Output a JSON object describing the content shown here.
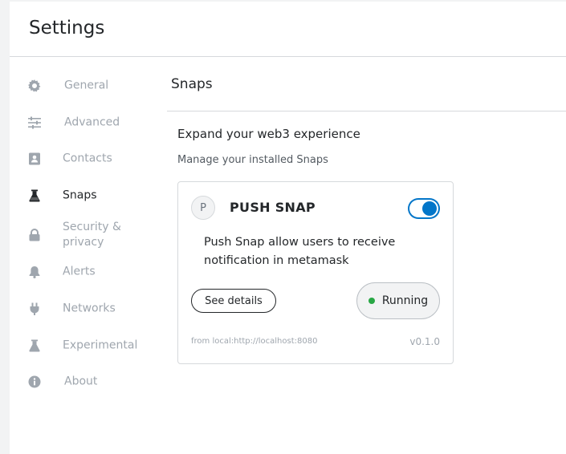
{
  "header": {
    "title": "Settings"
  },
  "sidebar": {
    "items": [
      {
        "label": "General",
        "icon": "gear-icon",
        "active": false
      },
      {
        "label": "Advanced",
        "icon": "sliders-icon",
        "active": false
      },
      {
        "label": "Contacts",
        "icon": "contact-book-icon",
        "active": false
      },
      {
        "label": "Snaps",
        "icon": "flask-icon",
        "active": true
      },
      {
        "label": "Security & privacy",
        "icon": "lock-icon",
        "active": false
      },
      {
        "label": "Alerts",
        "icon": "bell-icon",
        "active": false
      },
      {
        "label": "Networks",
        "icon": "plug-icon",
        "active": false
      },
      {
        "label": "Experimental",
        "icon": "flask-icon",
        "active": false
      },
      {
        "label": "About",
        "icon": "info-icon",
        "active": false
      }
    ]
  },
  "main": {
    "title": "Snaps",
    "section_title": "Expand your web3 experience",
    "section_subtitle": "Manage your installed Snaps"
  },
  "snap": {
    "avatar_letter": "P",
    "name": "PUSH SNAP",
    "enabled": true,
    "description": "Push Snap allow users to receive notification in metamask",
    "details_label": "See details",
    "status": "Running",
    "origin": "from local:http://localhost:8080",
    "version": "v0.1.0"
  },
  "colors": {
    "accent": "#0376c9",
    "running": "#28a745",
    "muted": "#9fa6ae",
    "text": "#24272a"
  }
}
